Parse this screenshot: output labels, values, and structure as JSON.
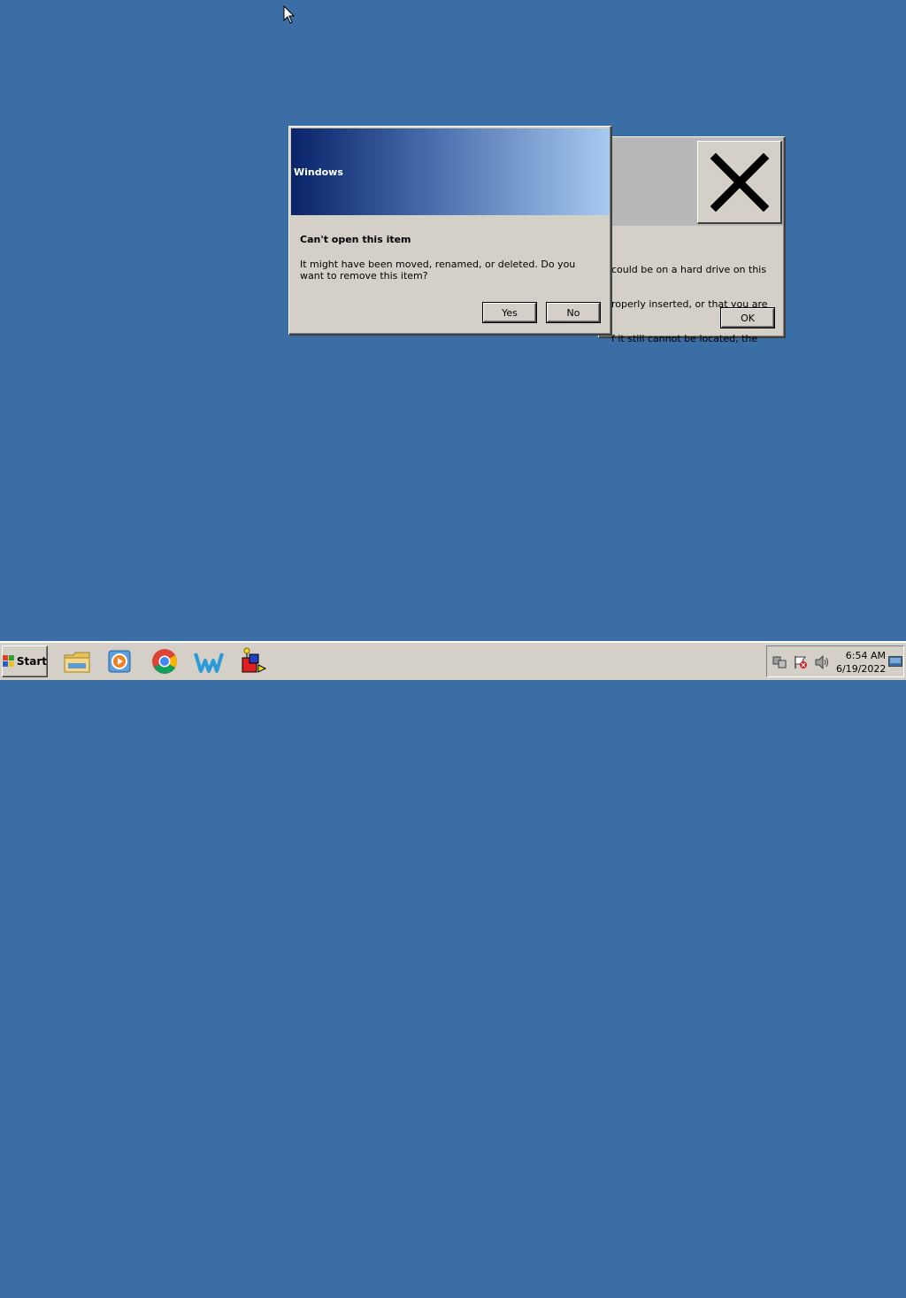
{
  "back_dialog": {
    "message_lines": [
      "could be on a hard drive on this",
      "roperly inserted, or that you are",
      "f it still cannot be located, the"
    ],
    "ok_label": "OK",
    "icon": "error-x-icon"
  },
  "front_dialog": {
    "title": "Windows",
    "heading": "Can't open this item",
    "message": "It might have been moved, renamed, or deleted. Do you want to remove this item?",
    "yes_label": "Yes",
    "no_label": "No"
  },
  "taskbar": {
    "start_label": "Start",
    "quick_launch": [
      {
        "name": "file-explorer-icon"
      },
      {
        "name": "media-player-icon"
      },
      {
        "name": "chrome-icon"
      },
      {
        "name": "w-app-icon"
      },
      {
        "name": "3d-shapes-app-icon"
      }
    ],
    "tray_icons": [
      "network-icon",
      "action-center-flag-icon",
      "volume-icon"
    ],
    "clock": {
      "time": "6:54 AM",
      "date": "6/19/2022"
    }
  },
  "colors": {
    "desktop": "#3b6ea5",
    "face": "#d4d0c8",
    "title_gradient_start": "#0a246a",
    "title_gradient_end": "#a6caf0"
  }
}
